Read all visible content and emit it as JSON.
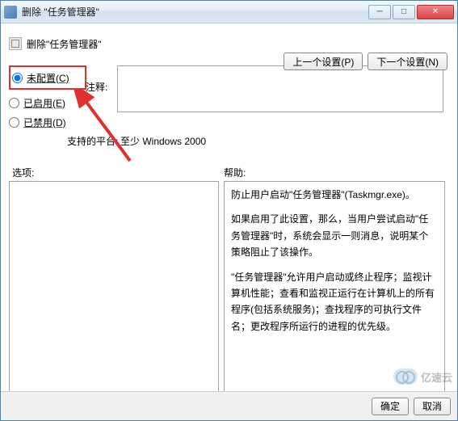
{
  "window": {
    "title": "删除 \"任务管理器\""
  },
  "header": {
    "text": "删除\"任务管理器\""
  },
  "nav": {
    "prev": "上一个设置(P)",
    "next": "下一个设置(N)"
  },
  "radios": {
    "not_configured": "未配置(C)",
    "enabled": "已启用(E)",
    "disabled": "已禁用(D)"
  },
  "labels": {
    "comment": "注释:",
    "platform": "支持的平台:",
    "options": "选项:",
    "help": "帮助:"
  },
  "platform_value": "至少 Windows 2000",
  "help": {
    "p1": "防止用户启动\"任务管理器\"(Taskmgr.exe)。",
    "p2": "如果启用了此设置，那么，当用户尝试启动\"任务管理器\"时，系统会显示一则消息，说明某个策略阻止了该操作。",
    "p3": "\"任务管理器\"允许用户启动或终止程序；监视计算机性能；查看和监视正运行在计算机上的所有程序(包括系统服务)；查找程序的可执行文件名；更改程序所运行的进程的优先级。"
  },
  "buttons": {
    "ok": "确定",
    "cancel": "取消"
  },
  "watermark": "亿速云"
}
